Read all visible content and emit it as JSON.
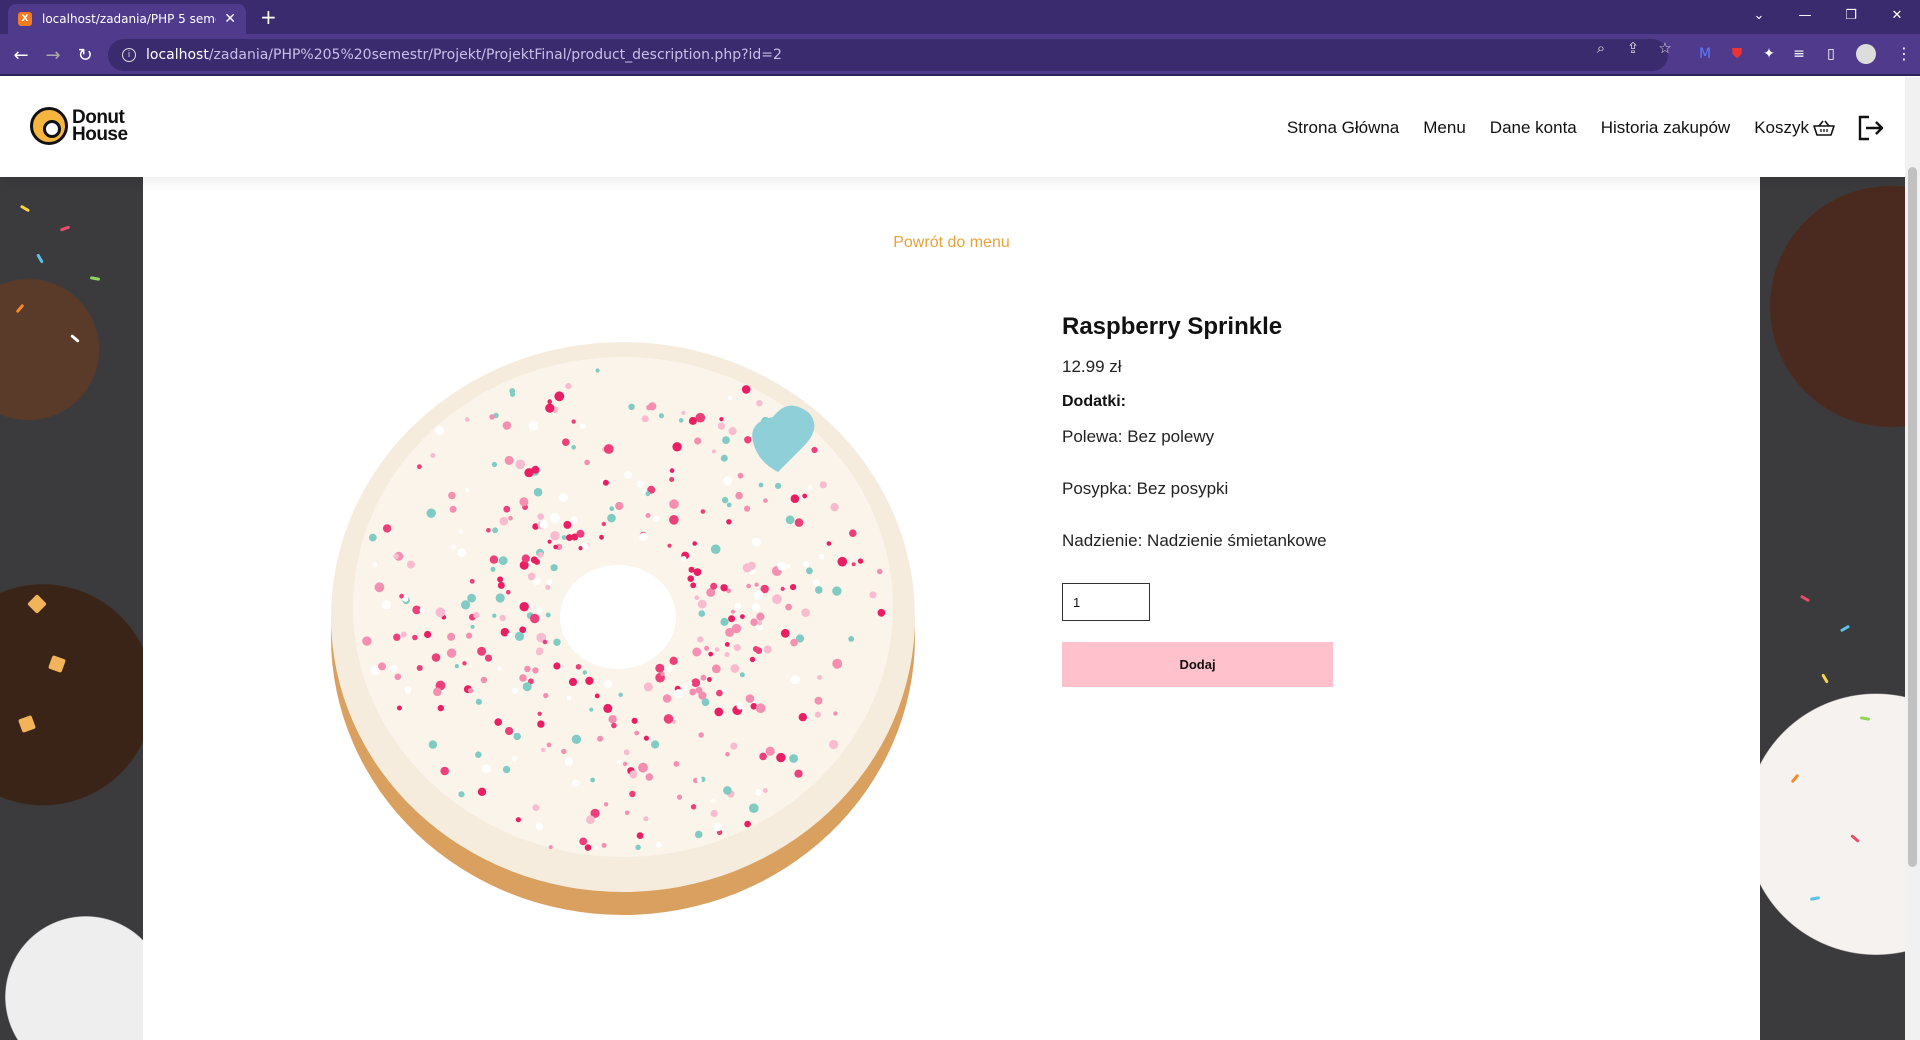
{
  "browser": {
    "tab_title": "localhost/zadania/PHP 5 semestr",
    "tab_favicon": "xampp-icon",
    "url_host": "localhost",
    "url_path": "/zadania/PHP%205%20semestr/Projekt/ProjektFinal/product_description.php?id=2",
    "theme_color": "#4f3a8c"
  },
  "header": {
    "logo_line1": "Donut",
    "logo_line2": "House",
    "nav": {
      "home": "Strona Główna",
      "menu": "Menu",
      "account": "Dane konta",
      "history": "Historia zakupów",
      "cart": "Koszyk"
    }
  },
  "product": {
    "back_link": "Powrót do menu",
    "name": "Raspberry Sprinkle",
    "price": "12.99 zł",
    "addons_heading": "Dodatki:",
    "glaze": "Polewa: Bez polewy",
    "topping": "Posypka: Bez posypki",
    "filling": "Nadzienie: Nadzienie śmietankowe",
    "quantity": "1",
    "add_button": "Dodaj",
    "accent_color": "#e8a23a",
    "button_color": "#ffc1cc"
  }
}
